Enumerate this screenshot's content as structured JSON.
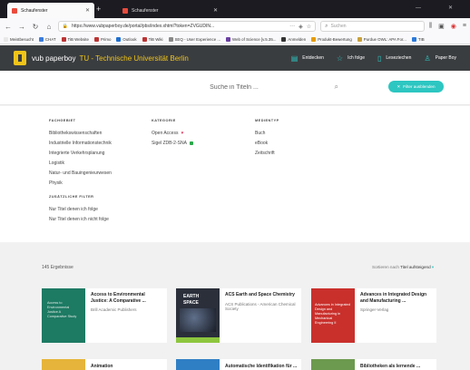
{
  "browser": {
    "tabs": [
      {
        "title": "Schaufenster",
        "active": true
      },
      {
        "title": "Schaufenster",
        "active": false
      }
    ],
    "url": "https://www.vubpaperboy.de/portal/pbs/index.xhtml?token=ZVGUDIN...",
    "url_overflow": "···",
    "search_placeholder": "Suchen",
    "bookmarks": [
      {
        "label": "Meistbesucht",
        "color": "#e8e8e8"
      },
      {
        "label": "CHAT",
        "color": "#3b7ddd"
      },
      {
        "label": "TiB Website",
        "color": "#b33"
      },
      {
        "label": "Primo",
        "color": "#b33"
      },
      {
        "label": "Outlook",
        "color": "#1e6fd0"
      },
      {
        "label": "TiB Wiki",
        "color": "#b33"
      },
      {
        "label": "SEQ - User Experience ...",
        "color": "#888"
      },
      {
        "label": "Web of Science [v.5.35...",
        "color": "#6a3ea1"
      },
      {
        "label": "Anmelden",
        "color": "#333"
      },
      {
        "label": "Produkt-Bewertung",
        "color": "#e69b00"
      },
      {
        "label": "Purdue OWL: APA For...",
        "color": "#c9a13b"
      },
      {
        "label": "TIB",
        "color": "#2a7ad9"
      }
    ]
  },
  "header": {
    "brand": "vub paperboy",
    "institution": "TU - Technische Universität Berlin",
    "nav": [
      {
        "label": "Entdecken",
        "icon": "document-icon"
      },
      {
        "label": "Ich folge",
        "icon": "star-icon"
      },
      {
        "label": "Leseziechen",
        "icon": "bookmark-icon"
      },
      {
        "label": "Paper Boy",
        "icon": "person-icon"
      }
    ]
  },
  "search": {
    "placeholder": "Suche in Titeln ...",
    "filter_button": "Filter ausblenden"
  },
  "filters": {
    "fachgebiet": {
      "heading": "FACHGEBIET",
      "items": [
        "Bibliothekswissenschaften",
        "Industrielle Informationstechnik",
        "Integrierte Verkehrsplanung",
        "Logistik",
        "Natur- und Bauingenieurwesen",
        "Physik"
      ]
    },
    "kategorie": {
      "heading": "KATEGORIE",
      "items": [
        {
          "label": "Open Access",
          "marker": "heart"
        },
        {
          "label": "Sigel ZDB-2-SNA",
          "marker": "green"
        }
      ]
    },
    "medientyp": {
      "heading": "MEDIENTYP",
      "items": [
        "Buch",
        "eBook",
        "Zeitschrift"
      ]
    },
    "zusaetzlich": {
      "heading": "ZUSÄTZLICHE FILTER",
      "items": [
        "Nur Titel denen ich folge",
        "Nur Titel denen ich nicht folge"
      ]
    }
  },
  "results": {
    "count": "145 Ergebnisse",
    "sort_label": "Sortieren nach",
    "sort_value": "Titel aufsteigend",
    "cards": [
      {
        "title": "Access to Environmental Justice: A Comparative ...",
        "publisher": "Brill Academic Publishers",
        "cover_color": "#1d7a63",
        "cover_text": "Access to Environmental Justice A Comparative Study"
      },
      {
        "title": "ACS Earth and Space Chemistry",
        "publisher": "ACS Publications - American Chemical Society",
        "cover_color": "#2a2f3a",
        "cover_text": "EARTH SPACE"
      },
      {
        "title": "Advances in Integrated Design and Manufacturing ...",
        "publisher": "Springer-Verlag",
        "cover_color": "#c9302c",
        "cover_text": "Advances in Integrated Design and Manufacturing in Mechanical Engineering II"
      }
    ],
    "cards_row2": [
      {
        "title": "Animation",
        "cover_color": "#e6b43a"
      },
      {
        "title": "Automatische Identifikation für ...",
        "cover_color": "#2f7fc4"
      },
      {
        "title": "Bibliotheken als lernende ...",
        "cover_color": "#6c9a4e"
      }
    ]
  }
}
